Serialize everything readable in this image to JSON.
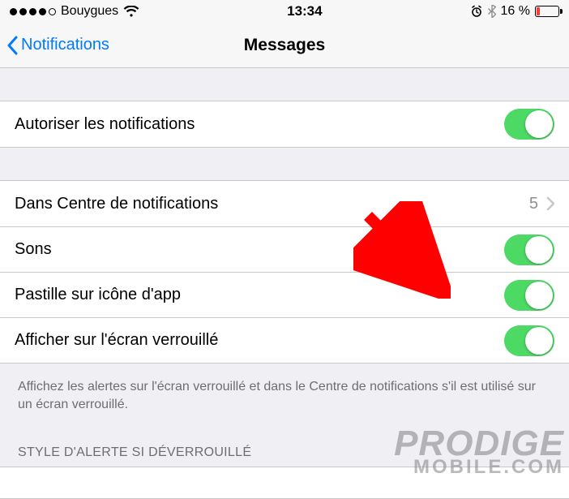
{
  "status": {
    "carrier": "Bouygues",
    "time": "13:34",
    "battery_pct": "16 %"
  },
  "nav": {
    "back_label": "Notifications",
    "title": "Messages"
  },
  "group1": {
    "allow_notifications": "Autoriser les notifications"
  },
  "group2": {
    "notification_center": "Dans Centre de notifications",
    "nc_value": "5",
    "sounds": "Sons",
    "badge": "Pastille sur icône d'app",
    "lock_screen": "Afficher sur l'écran verrouillé"
  },
  "footer": "Affichez les alertes sur l'écran verrouillé et dans le Centre de notifications s'il est utilisé sur un écran verrouillé.",
  "section_header": "STYLE D'ALERTE SI DÉVERROUILLÉ",
  "watermark": {
    "line1": "PRODIGE",
    "line2": "MOBILE.COM"
  }
}
